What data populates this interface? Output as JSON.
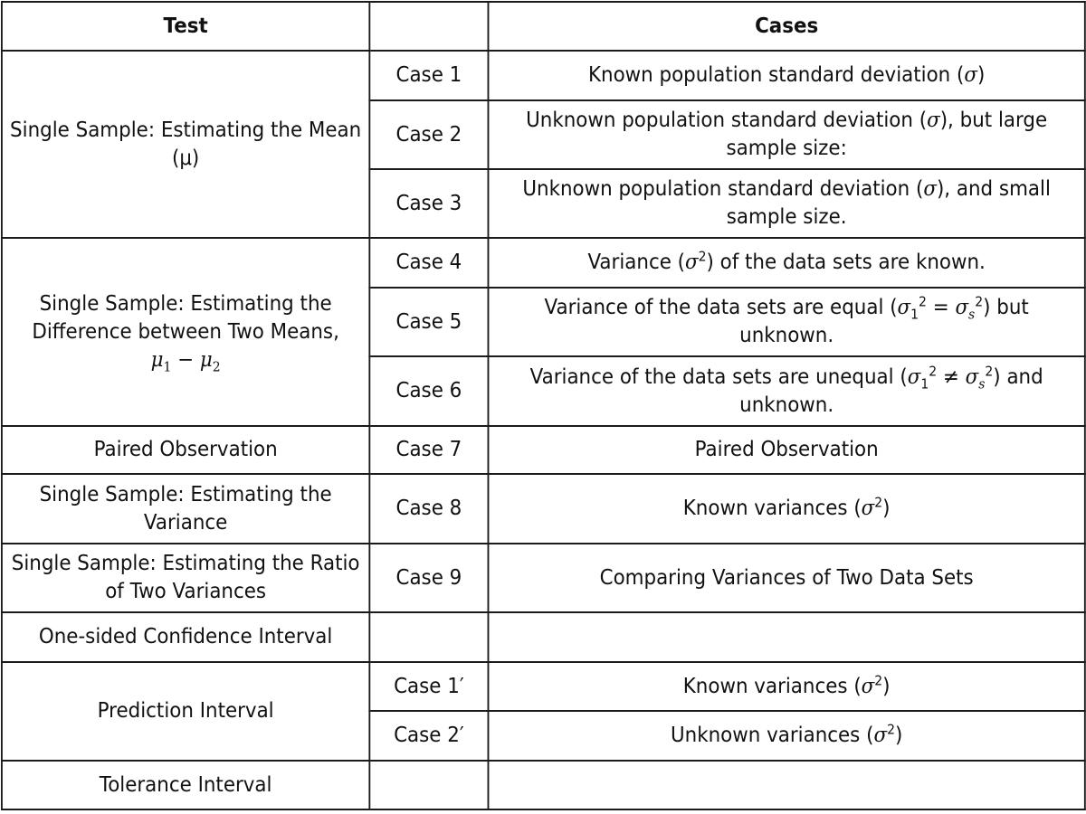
{
  "table": {
    "headers": {
      "test": "Test",
      "case": "",
      "cases": "Cases"
    },
    "groups": [
      {
        "test": "Single Sample: Estimating the Mean (μ)",
        "rows": [
          {
            "case": "Case 1",
            "description": "Known population standard deviation (σ)"
          },
          {
            "case": "Case 2",
            "description": "Unknown population standard deviation (σ), but large sample size:"
          },
          {
            "case": "Case 3",
            "description": "Unknown population standard deviation (σ), and small sample size."
          }
        ]
      },
      {
        "test": "Single Sample: Estimating the Difference between Two Means,",
        "test_math": "μ₁ − μ₂",
        "rows": [
          {
            "case": "Case 4",
            "description": "Variance (σ²) of the data sets are known."
          },
          {
            "case": "Case 5",
            "description": "Variance of the data sets are equal (σ₁² = σₛ²) but unknown."
          },
          {
            "case": "Case 6",
            "description": "Variance of the data sets are unequal (σ₁² ≠ σₛ²) and unknown."
          }
        ]
      },
      {
        "test": "Paired Observation",
        "rows": [
          {
            "case": "Case 7",
            "description": "Paired Observation"
          }
        ]
      },
      {
        "test": "Single Sample: Estimating the Variance",
        "rows": [
          {
            "case": "Case 8",
            "description": "Known variances (σ²)"
          }
        ]
      },
      {
        "test": "Single Sample: Estimating the Ratio of Two Variances",
        "rows": [
          {
            "case": "Case 9",
            "description": "Comparing Variances of Two Data Sets"
          }
        ]
      },
      {
        "test": "One-sided Confidence Interval",
        "rows": [
          {
            "case": "",
            "description": ""
          }
        ]
      },
      {
        "test": "Prediction Interval",
        "rows": [
          {
            "case": "Case 1′",
            "description": "Known variances (σ²)"
          },
          {
            "case": "Case 2′",
            "description": "Unknown variances (σ²)"
          }
        ]
      },
      {
        "test": "Tolerance Interval",
        "rows": [
          {
            "case": "",
            "description": ""
          }
        ]
      }
    ],
    "fragments": {
      "g0r0": {
        "pre": "Known population standard deviation (",
        "sym": "σ",
        "post": ")"
      },
      "g0r1": {
        "pre": "Unknown population standard deviation (",
        "sym": "σ",
        "post": "), but large sample size:"
      },
      "g0r2": {
        "pre": "Unknown population standard deviation (",
        "sym": "σ",
        "post": "), and small sample size."
      },
      "g1r0": {
        "pre": "Variance (",
        "sym": "σ",
        "sup": "2",
        "post": ") of the data sets are known."
      },
      "g1r1": {
        "pre": "Variance of the data sets are equal (",
        "a": "σ",
        "a_sub": "1",
        "a_sup": "2",
        "op": " = ",
        "b": "σ",
        "b_sub": "s",
        "b_sup": "2",
        "post": ") but unknown."
      },
      "g1r2": {
        "pre": "Variance of the data sets are unequal (",
        "a": "σ",
        "a_sub": "1",
        "a_sup": "2",
        "op": " ≠ ",
        "b": "σ",
        "b_sub": "s",
        "b_sup": "2",
        "post": ") and unknown."
      },
      "g1test_math": {
        "a": "μ",
        "a_sub": "1",
        "op": " − ",
        "b": "μ",
        "b_sub": "2"
      },
      "g3r0": {
        "pre": "Known variances (",
        "sym": "σ",
        "sup": "2",
        "post": ")"
      },
      "g6r0": {
        "pre": "Known variances (",
        "sym": "σ",
        "sup": "2",
        "post": ")"
      },
      "g6r1": {
        "pre": "Unknown variances (",
        "sym": "σ",
        "sup": "2",
        "post": ")"
      }
    }
  }
}
